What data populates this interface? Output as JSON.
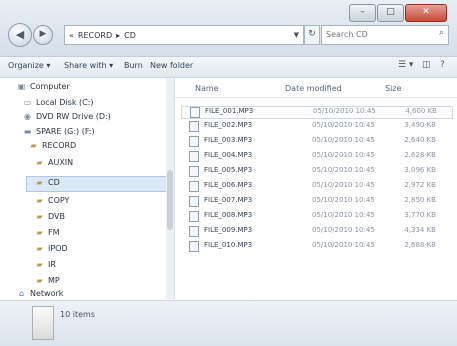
{
  "window": {
    "controls": {
      "minimize": "–",
      "maximize": "□",
      "close": "✕"
    },
    "address_segments": [
      "«",
      "RECORD",
      "▸",
      "CD"
    ],
    "search_placeholder": "Search CD"
  },
  "toolbar": {
    "organize": "Organize ▾",
    "share_with": "Share with ▾",
    "burn": "Burn",
    "new_folder": "New folder",
    "view_icon": "☰ ▾",
    "pane_icon": "◫",
    "help_icon": "?"
  },
  "sidebar": {
    "items": [
      {
        "label": "Computer",
        "icon": "computer-icon"
      },
      {
        "label": "Local Disk (C:)",
        "icon": "drive-icon"
      },
      {
        "label": "DVD RW Drive (D:)",
        "icon": "dvd-drive-icon"
      },
      {
        "label": "SPARE (G:) (F:)",
        "icon": "drive-icon"
      },
      {
        "label": "RECORD",
        "icon": "folder-icon"
      },
      {
        "label": "AUXIN",
        "icon": "folder-icon"
      },
      {
        "label": "CD",
        "icon": "folder-icon"
      },
      {
        "label": "COPY",
        "icon": "folder-icon"
      },
      {
        "label": "DVB",
        "icon": "folder-icon"
      },
      {
        "label": "FM",
        "icon": "folder-icon"
      },
      {
        "label": "IPOD",
        "icon": "folder-icon"
      },
      {
        "label": "IR",
        "icon": "folder-icon"
      },
      {
        "label": "MP",
        "icon": "folder-icon"
      },
      {
        "label": "Network",
        "icon": "network-icon"
      }
    ],
    "selected": "CD"
  },
  "list": {
    "columns": {
      "name": "Name",
      "date": "Date modified",
      "size": "Size"
    },
    "files": [
      {
        "name": "FILE_001.MP3",
        "date": "05/10/2010 10:45",
        "size": "4,600 KB"
      },
      {
        "name": "FILE_002.MP3",
        "date": "05/10/2010 10:45",
        "size": "3,490 KB"
      },
      {
        "name": "FILE_003.MP3",
        "date": "05/10/2010 10:45",
        "size": "2,640 KB"
      },
      {
        "name": "FILE_004.MP3",
        "date": "05/10/2010 10:45",
        "size": "2,628 KB"
      },
      {
        "name": "FILE_005.MP3",
        "date": "05/10/2010 10:45",
        "size": "3,096 KB"
      },
      {
        "name": "FILE_006.MP3",
        "date": "05/10/2010 10:45",
        "size": "2,972 KB"
      },
      {
        "name": "FILE_007.MP3",
        "date": "05/10/2010 10:45",
        "size": "2,850 KB"
      },
      {
        "name": "FILE_008.MP3",
        "date": "05/10/2010 10:45",
        "size": "3,770 KB"
      },
      {
        "name": "FILE_009.MP3",
        "date": "05/10/2010 10:45",
        "size": "4,334 KB"
      },
      {
        "name": "FILE_010.MP3",
        "date": "05/10/2010 10:45",
        "size": "2,688 KB"
      }
    ]
  },
  "status": {
    "item_count": "10 items"
  }
}
